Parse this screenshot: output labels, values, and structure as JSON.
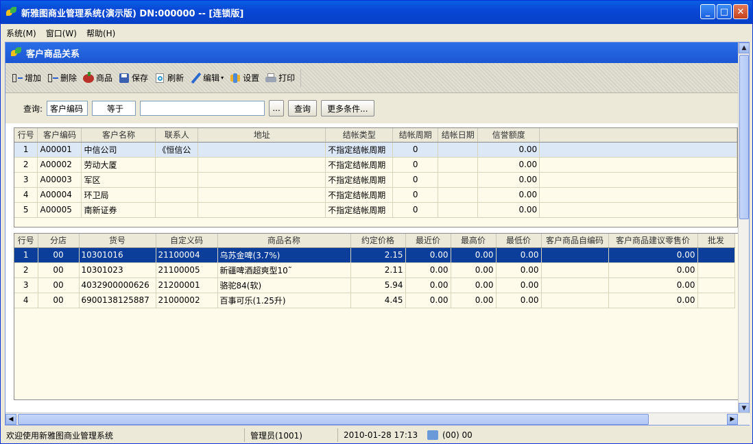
{
  "window": {
    "title": "新雅图商业管理系统(演示版) DN:000000 -- [连锁版]"
  },
  "menu": [
    "系统(M)",
    "窗口(W)",
    "帮助(H)"
  ],
  "child": {
    "title": "客户商品关系"
  },
  "toolbar": {
    "add": "增加",
    "delete": "删除",
    "goods": "商品",
    "save": "保存",
    "refresh": "刷新",
    "edit": "编辑",
    "settings": "设置",
    "print": "打印"
  },
  "query": {
    "label": "查询:",
    "field": "客户编码",
    "op": "等于",
    "value": "",
    "ellipsis": "...",
    "search": "查询",
    "more": "更多条件..."
  },
  "customers": {
    "headers": [
      "行号",
      "客户编码",
      "客户名称",
      "联系人",
      "地址",
      "结帐类型",
      "结帐周期",
      "结帐日期",
      "信誉额度"
    ],
    "rows": [
      [
        "1",
        "A00001",
        "中信公司",
        "《恒信公",
        "",
        "不指定结帐周期",
        "0",
        "",
        "0.00"
      ],
      [
        "2",
        "A00002",
        "劳动大厦",
        "",
        "",
        "不指定结帐周期",
        "0",
        "",
        "0.00"
      ],
      [
        "3",
        "A00003",
        "军区",
        "",
        "",
        "不指定结帐周期",
        "0",
        "",
        "0.00"
      ],
      [
        "4",
        "A00004",
        "环卫局",
        "",
        "",
        "不指定结帐周期",
        "0",
        "",
        "0.00"
      ],
      [
        "5",
        "A00005",
        "南新证券",
        "",
        "",
        "不指定结帐周期",
        "0",
        "",
        "0.00"
      ]
    ]
  },
  "goods": {
    "headers": [
      "行号",
      "分店",
      "货号",
      "自定义码",
      "商品名称",
      "约定价格",
      "最近价",
      "最高价",
      "最低价",
      "客户商品自编码",
      "客户商品建议零售价",
      "批发"
    ],
    "rows": [
      [
        "1",
        "00",
        "10301016",
        "21100004",
        "乌苏金啤(3.7%)",
        "2.15",
        "0.00",
        "0.00",
        "0.00",
        "",
        "0.00",
        ""
      ],
      [
        "2",
        "00",
        "10301023",
        "21100005",
        "新疆啤酒超爽型10˜",
        "2.11",
        "0.00",
        "0.00",
        "0.00",
        "",
        "0.00",
        ""
      ],
      [
        "3",
        "00",
        "4032900000626",
        "21200001",
        "骆驼84(软)",
        "5.94",
        "0.00",
        "0.00",
        "0.00",
        "",
        "0.00",
        ""
      ],
      [
        "4",
        "00",
        "6900138125887",
        "21000002",
        "百事可乐(1.25升)",
        "4.45",
        "0.00",
        "0.00",
        "0.00",
        "",
        "0.00",
        ""
      ]
    ]
  },
  "status": {
    "welcome": "欢迎使用新雅图商业管理系统",
    "user": "管理员(1001)",
    "datetime": "2010-01-28 17:13",
    "branch": "(00) 00"
  },
  "colors": {
    "title": "#0847d6",
    "selected_row": "#0a3e9a"
  }
}
